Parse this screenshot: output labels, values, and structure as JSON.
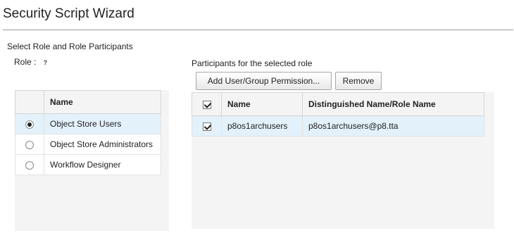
{
  "window": {
    "title": "Security Script Wizard"
  },
  "section": {
    "label": "Select Role and Role Participants"
  },
  "role": {
    "label": "Role :",
    "help_icon": "help-icon"
  },
  "roles_table": {
    "header": "Name",
    "rows": [
      {
        "name": "Object Store Users",
        "selected": true
      },
      {
        "name": "Object Store Administrators",
        "selected": false
      },
      {
        "name": "Workflow Designer",
        "selected": false
      }
    ]
  },
  "participants": {
    "label": "Participants for the selected role",
    "add_button": "Add User/Group Permission...",
    "remove_button": "Remove",
    "columns": [
      "Name",
      "Distinguished Name/Role Name"
    ],
    "rows": [
      {
        "name": "p8os1archusers",
        "dn": "p8os1archusers@p8.tta",
        "checked": true
      }
    ]
  },
  "colors": {
    "selected_row": "#e3f1fb",
    "header_bg": "#f4f4f4"
  }
}
